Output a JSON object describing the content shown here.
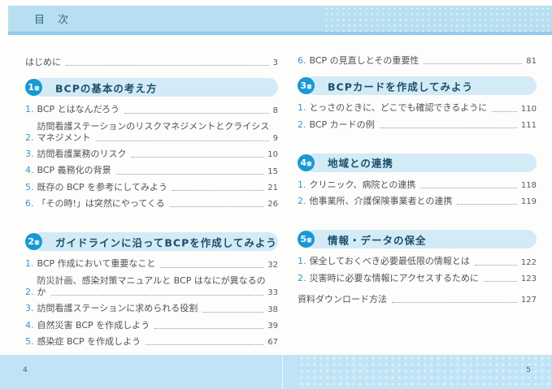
{
  "header": {
    "title": "目 次"
  },
  "intro": {
    "label": "はじめに",
    "page": "3"
  },
  "chapters": [
    {
      "badge": {
        "num": "1",
        "suffix": "章"
      },
      "title": "BCPの基本の考え方",
      "items": [
        {
          "num": "1.",
          "line1": "BCP とはなんだろう",
          "page": "8"
        },
        {
          "num": "2.",
          "line1": "訪問看護ステーションのリスクマネジメントとクライシス",
          "line2": "マネジメント",
          "page": "9"
        },
        {
          "num": "3.",
          "line1": "訪問看護業務のリスク",
          "page": "10"
        },
        {
          "num": "4.",
          "line1": "BCP 義務化の背景",
          "page": "15"
        },
        {
          "num": "5.",
          "line1": "既存の BCP を参考にしてみよう",
          "page": "21"
        },
        {
          "num": "6.",
          "line1": "「その時!」は突然にやってくる",
          "page": "26"
        }
      ]
    },
    {
      "badge": {
        "num": "2",
        "suffix": "章"
      },
      "title": "ガイドラインに沿ってBCPを作成してみよう",
      "items": [
        {
          "num": "1.",
          "line1": "BCP 作成において重要なこと",
          "page": "32"
        },
        {
          "num": "2.",
          "line1": "防災計画、感染対策マニュアルと BCP はなにが異なるの",
          "line2": "か",
          "page": "33"
        },
        {
          "num": "3.",
          "line1": "訪問看護ステーションに求められる役割",
          "page": "38"
        },
        {
          "num": "4.",
          "line1": "自然災害 BCP を作成しよう",
          "page": "39"
        },
        {
          "num": "5.",
          "line1": "感染症 BCP を作成しよう",
          "page": "67"
        },
        {
          "num": "6.",
          "line1": "BCP の見直しとその重要性",
          "page": "81"
        }
      ]
    },
    {
      "badge": {
        "num": "3",
        "suffix": "章"
      },
      "title": "BCPカードを作成してみよう",
      "items": [
        {
          "num": "1.",
          "line1": "とっさのときに、どこでも確認できるように",
          "page": "110"
        },
        {
          "num": "2.",
          "line1": "BCP カードの例",
          "page": "111"
        }
      ]
    },
    {
      "badge": {
        "num": "4",
        "suffix": "章"
      },
      "title": "地域との連携",
      "items": [
        {
          "num": "1.",
          "line1": "クリニック、病院との連携",
          "page": "118"
        },
        {
          "num": "2.",
          "line1": "他事業所、介護保険事業者との連携",
          "page": "119"
        }
      ]
    },
    {
      "badge": {
        "num": "5",
        "suffix": "章"
      },
      "title": "情報・データの保全",
      "items": [
        {
          "num": "1.",
          "line1": "保全しておくべき必要最低限の情報とは",
          "page": "122"
        },
        {
          "num": "2.",
          "line1": "災害時に必要な情報にアクセスするために",
          "page": "123"
        }
      ]
    }
  ],
  "appendix": {
    "label": "資料ダウンロード方法",
    "page": "127"
  },
  "footer": {
    "left_page": "4",
    "right_page": "5"
  },
  "colors": {
    "band_blue": "#b7dff1",
    "band_edge_blue": "#8ecbe6",
    "footer_blue": "#c0e4f5",
    "pill_blue": "#d3eaf7",
    "badge_blue": "#1899d3",
    "heading_text": "#1c4f68",
    "item_number_blue": "#2f9cc9",
    "body_text": "#4e5356"
  }
}
